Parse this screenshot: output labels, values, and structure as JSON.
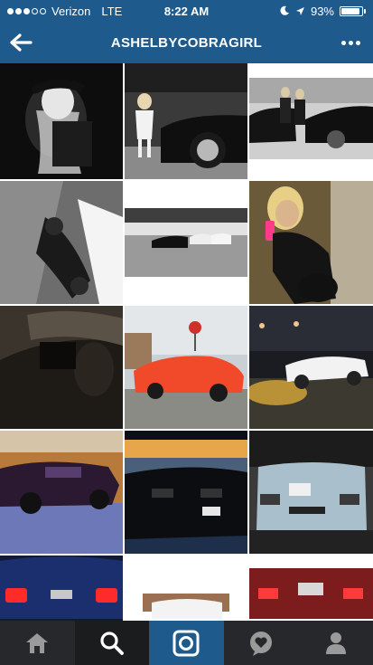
{
  "status": {
    "carrier": "Verizon",
    "network": "LTE",
    "time": "8:22 AM",
    "battery": "93%",
    "battery_level": 0.93
  },
  "header": {
    "title": "ASHELBYCOBRAGIRL"
  },
  "photos": [
    {
      "name": "photo-woman-black-hat",
      "interactable": true
    },
    {
      "name": "photo-woman-white-dress-mustang",
      "interactable": true
    },
    {
      "name": "photo-two-women-black-mustangs",
      "interactable": true
    },
    {
      "name": "photo-mustang-parking-garage-tilted",
      "interactable": true
    },
    {
      "name": "photo-cars-parking-deck",
      "interactable": true
    },
    {
      "name": "photo-woman-selfie-pink-phone",
      "interactable": true
    },
    {
      "name": "photo-mustang-closeup-dark",
      "interactable": true
    },
    {
      "name": "photo-orange-mustang",
      "interactable": true
    },
    {
      "name": "photo-white-cobra-night",
      "interactable": true
    },
    {
      "name": "photo-purple-mustang-snow",
      "interactable": true
    },
    {
      "name": "photo-black-mustang-sunset",
      "interactable": true
    },
    {
      "name": "photo-silver-cobra-rear",
      "interactable": true
    },
    {
      "name": "photo-mustang-taillights",
      "interactable": true
    },
    {
      "name": "photo-white-car-building",
      "interactable": true
    },
    {
      "name": "photo-red-mustang-rear",
      "interactable": true
    }
  ],
  "tabs": [
    {
      "name": "tab-home",
      "icon": "home-icon"
    },
    {
      "name": "tab-search",
      "icon": "search-icon"
    },
    {
      "name": "tab-camera",
      "icon": "camera-icon"
    },
    {
      "name": "tab-activity",
      "icon": "heart-bubble-icon"
    },
    {
      "name": "tab-profile",
      "icon": "profile-icon"
    }
  ],
  "colors": {
    "header_bg": "#1e5b8c",
    "tabbar_bg": "#26282b",
    "tab_active": "#1e5b8c"
  }
}
